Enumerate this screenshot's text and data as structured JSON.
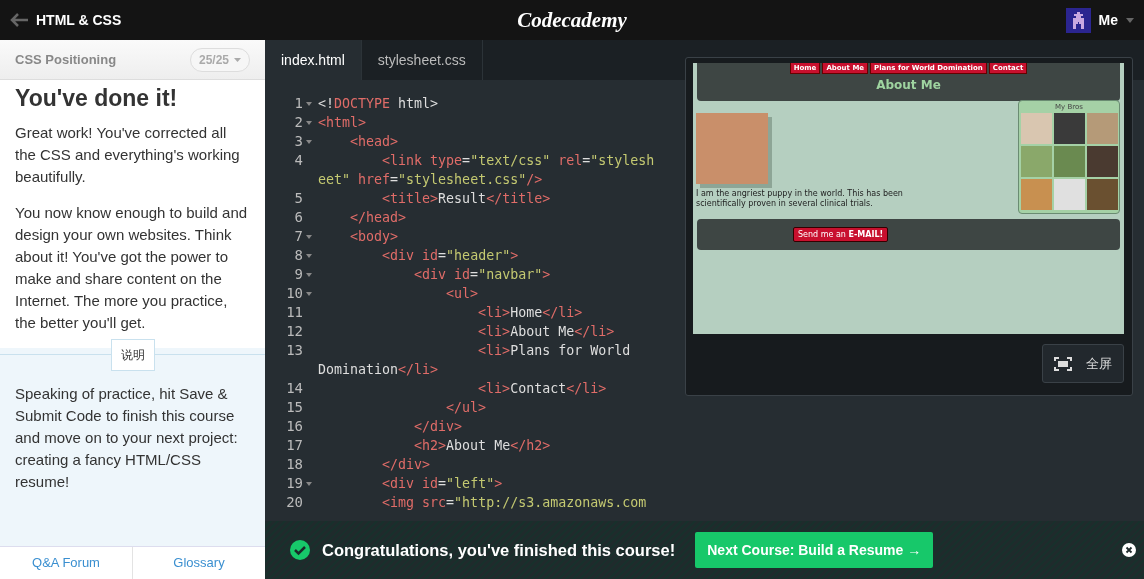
{
  "topbar": {
    "back_label": "HTML & CSS",
    "logo": "Codecademy",
    "user": "Me"
  },
  "lesson": {
    "section": "CSS Positioning",
    "progress": "25/25",
    "heading": "You've done it!",
    "paragraphs": [
      "Great work! You've corrected all the CSS and everything's working beautifully.",
      "You now know enough to build and design your own websites. Think about it! You've got the power to make and share content on the Internet. The more you practice, the better you'll get."
    ],
    "divider_label": "说明",
    "instructions": "Speaking of practice, hit Save & Submit Code to finish this course and move on to your next project: creating a fancy HTML/CSS resume!",
    "links": [
      "Q&A Forum",
      "Glossary"
    ]
  },
  "editor": {
    "tabs": [
      {
        "label": "index.html",
        "selected": true
      },
      {
        "label": "stylesheet.css",
        "selected": false
      }
    ],
    "lines": [
      {
        "number": "1",
        "fold": true,
        "tokens": [
          {
            "kind": "text",
            "text": "<!"
          },
          {
            "kind": "tag",
            "text": "DOCTYPE"
          },
          {
            "kind": "text",
            "text": " html>"
          }
        ]
      },
      {
        "number": "2",
        "fold": true,
        "tokens": [
          {
            "kind": "tag",
            "text": "<html>"
          }
        ]
      },
      {
        "number": "3",
        "fold": true,
        "tokens": [
          {
            "kind": "tag",
            "text": "    <head>"
          }
        ]
      },
      {
        "number": "4",
        "fold": false,
        "tokens": [
          {
            "kind": "tag",
            "text": "        <link type"
          },
          {
            "kind": "text",
            "text": "="
          },
          {
            "kind": "string",
            "text": "\"text/css\""
          },
          {
            "kind": "tag",
            "text": " rel"
          },
          {
            "kind": "text",
            "text": "="
          },
          {
            "kind": "string",
            "text": "\"stylesh"
          },
          {
            "kind": "string",
            "text": "eet\"",
            "break": true
          },
          {
            "kind": "tag",
            "text": " href"
          },
          {
            "kind": "text",
            "text": "="
          },
          {
            "kind": "string",
            "text": "\"stylesheet.css\""
          },
          {
            "kind": "tag",
            "text": "/>"
          }
        ]
      },
      {
        "number": "5",
        "fold": false,
        "tokens": [
          {
            "kind": "tag",
            "text": "        <title>"
          },
          {
            "kind": "text",
            "text": "Result"
          },
          {
            "kind": "tag",
            "text": "</title>"
          }
        ]
      },
      {
        "number": "6",
        "fold": false,
        "tokens": [
          {
            "kind": "tag",
            "text": "    </head>"
          }
        ]
      },
      {
        "number": "7",
        "fold": true,
        "tokens": [
          {
            "kind": "tag",
            "text": "    <body>"
          }
        ]
      },
      {
        "number": "8",
        "fold": true,
        "tokens": [
          {
            "kind": "tag",
            "text": "        <div id"
          },
          {
            "kind": "text",
            "text": "="
          },
          {
            "kind": "string",
            "text": "\"header\""
          },
          {
            "kind": "tag",
            "text": ">"
          }
        ]
      },
      {
        "number": "9",
        "fold": true,
        "tokens": [
          {
            "kind": "tag",
            "text": "            <div id"
          },
          {
            "kind": "text",
            "text": "="
          },
          {
            "kind": "string",
            "text": "\"navbar\""
          },
          {
            "kind": "tag",
            "text": ">"
          }
        ]
      },
      {
        "number": "10",
        "fold": true,
        "tokens": [
          {
            "kind": "tag",
            "text": "                <ul>"
          }
        ]
      },
      {
        "number": "11",
        "fold": false,
        "tokens": [
          {
            "kind": "tag",
            "text": "                    <li>"
          },
          {
            "kind": "text",
            "text": "Home"
          },
          {
            "kind": "tag",
            "text": "</li>"
          }
        ]
      },
      {
        "number": "12",
        "fold": false,
        "tokens": [
          {
            "kind": "tag",
            "text": "                    <li>"
          },
          {
            "kind": "text",
            "text": "About Me"
          },
          {
            "kind": "tag",
            "text": "</li>"
          }
        ]
      },
      {
        "number": "13",
        "fold": false,
        "tokens": [
          {
            "kind": "tag",
            "text": "                    <li>"
          },
          {
            "kind": "text",
            "text": "Plans for World"
          },
          {
            "kind": "text",
            "text": "Domination",
            "break": true
          },
          {
            "kind": "tag",
            "text": "</li>"
          }
        ]
      },
      {
        "number": "14",
        "fold": false,
        "tokens": [
          {
            "kind": "tag",
            "text": "                    <li>"
          },
          {
            "kind": "text",
            "text": "Contact"
          },
          {
            "kind": "tag",
            "text": "</li>"
          }
        ]
      },
      {
        "number": "15",
        "fold": false,
        "tokens": [
          {
            "kind": "tag",
            "text": "                </ul>"
          }
        ]
      },
      {
        "number": "16",
        "fold": false,
        "tokens": [
          {
            "kind": "tag",
            "text": "            </div>"
          }
        ]
      },
      {
        "number": "17",
        "fold": false,
        "tokens": [
          {
            "kind": "tag",
            "text": "            <h2>"
          },
          {
            "kind": "text",
            "text": "About Me"
          },
          {
            "kind": "tag",
            "text": "</h2>"
          }
        ]
      },
      {
        "number": "18",
        "fold": false,
        "tokens": [
          {
            "kind": "tag",
            "text": "        </div>"
          }
        ]
      },
      {
        "number": "19",
        "fold": true,
        "tokens": [
          {
            "kind": "tag",
            "text": "        <div id"
          },
          {
            "kind": "text",
            "text": "="
          },
          {
            "kind": "string",
            "text": "\"left\""
          },
          {
            "kind": "tag",
            "text": ">"
          }
        ]
      },
      {
        "number": "20",
        "fold": false,
        "tokens": [
          {
            "kind": "tag",
            "text": "        <img src"
          },
          {
            "kind": "text",
            "text": "="
          },
          {
            "kind": "string",
            "text": "\"http://s3.amazonaws.com"
          }
        ]
      }
    ]
  },
  "preview": {
    "nav": [
      "Home",
      "About Me",
      "Plans for World Domination",
      "Contact"
    ],
    "title": "About Me",
    "caption": "I am the angriest puppy in the world. This has been scientifically proven in several clinical trials.",
    "sidebar_title": "My Bros",
    "email_button": "Send me an **E-MAIL!**",
    "fullscreen": "全屏"
  },
  "banner": {
    "message": "Congratulations, you've finished this course!",
    "next_button": "Next Course: Build a Resume →"
  }
}
